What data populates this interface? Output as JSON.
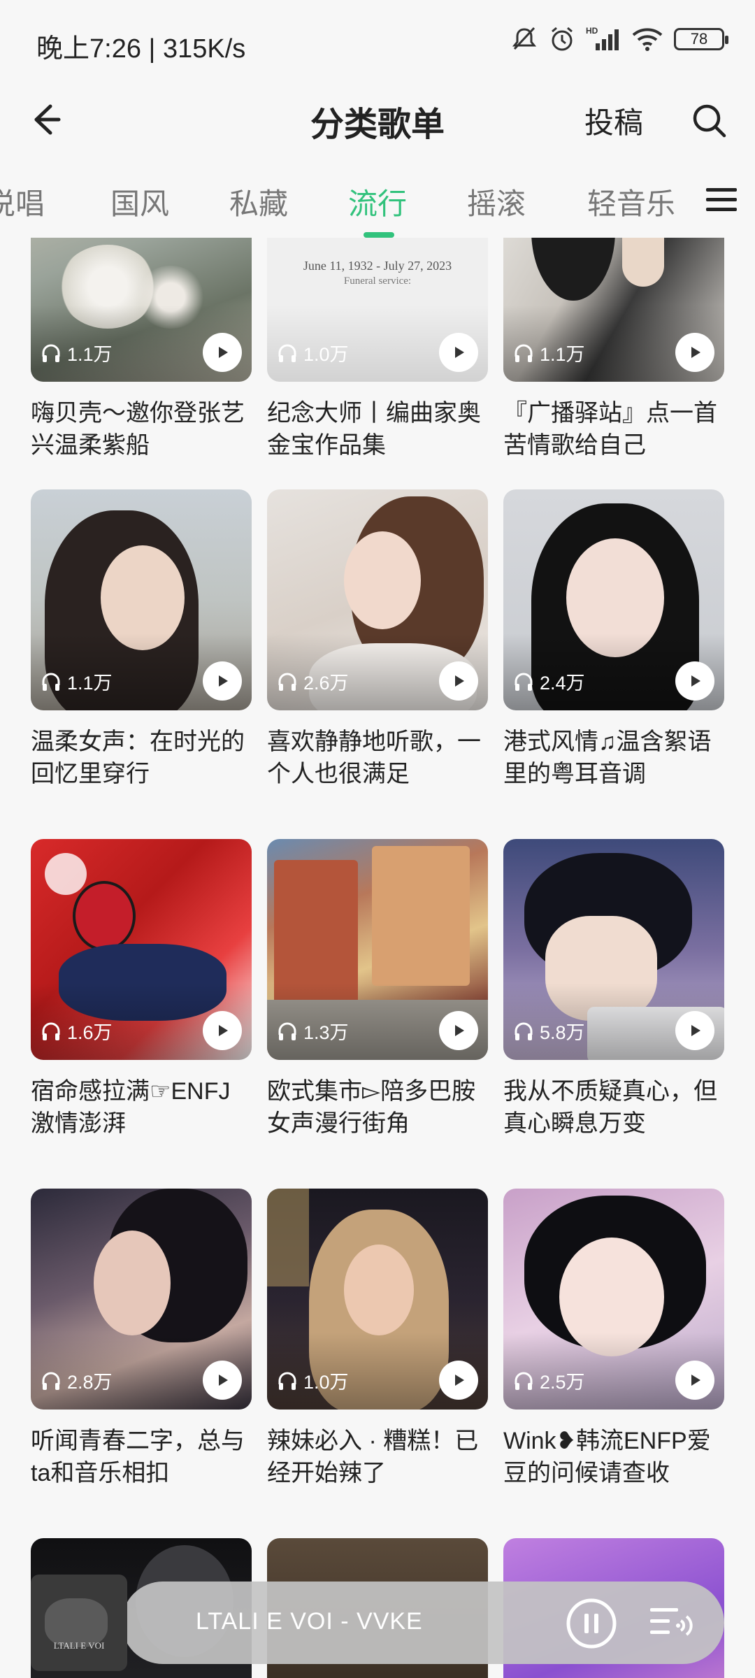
{
  "status_bar": {
    "time_speed": "晚上7:26 | 315K/s",
    "battery": "78",
    "network_badge": "HD"
  },
  "header": {
    "title": "分类歌单",
    "submit_label": "投稿"
  },
  "tabs": [
    {
      "label": "说唱",
      "active": false
    },
    {
      "label": "国风",
      "active": false
    },
    {
      "label": "私藏",
      "active": false
    },
    {
      "label": "流行",
      "active": true
    },
    {
      "label": "摇滚",
      "active": false
    },
    {
      "label": "轻音乐",
      "active": false
    }
  ],
  "playlists": [
    {
      "title": "嗨贝壳～邀你登张艺兴温柔紫船",
      "plays": "1.1万"
    },
    {
      "title": "纪念大师丨编曲家奥金宝作品集",
      "plays": "1.0万",
      "cover_text": "June 11, 1932 - July 27, 2023",
      "cover_caption": "Funeral service:"
    },
    {
      "title": "『广播驿站』点一首苦情歌给自己",
      "plays": "1.1万"
    },
    {
      "title": "温柔女声：在时光的回忆里穿行",
      "plays": "1.1万"
    },
    {
      "title": "喜欢静静地听歌，一个人也很满足",
      "plays": "2.6万"
    },
    {
      "title": "港式风情♫温含絮语里的粤耳音调",
      "plays": "2.4万"
    },
    {
      "title": "宿命感拉满☞ENFJ激情澎湃",
      "plays": "1.6万"
    },
    {
      "title": "欧式集市▻陪多巴胺女声漫行街角",
      "plays": "1.3万"
    },
    {
      "title": "我从不质疑真心，但真心瞬息万变",
      "plays": "5.8万"
    },
    {
      "title": "听闻青春二字，总与ta和音乐相扣",
      "plays": "2.8万"
    },
    {
      "title": "辣妹必入 · 糟糕！已经开始辣了",
      "plays": "1.0万"
    },
    {
      "title": "Wink❥韩流ENFP爱豆的问候请查收",
      "plays": "2.5万"
    },
    {
      "title": "",
      "plays": ""
    },
    {
      "title": "",
      "plays": ""
    },
    {
      "title": "",
      "plays": ""
    }
  ],
  "player": {
    "now_playing": "LTALI E VOI - VVKE",
    "art_text": "LTALI E VOI"
  },
  "colors": {
    "accent": "#31c27c",
    "background": "#f7f7f7"
  }
}
